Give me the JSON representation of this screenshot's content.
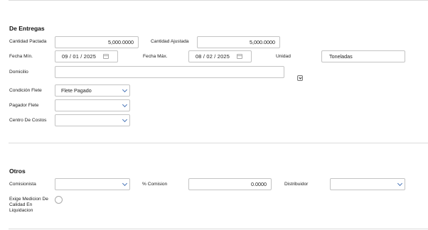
{
  "entregas": {
    "title": "De Entregas",
    "cantidad_pactada": {
      "label": "Cantidad Pactada",
      "value": "5,000.0000"
    },
    "cantidad_ajustada": {
      "label": "Cantidad Ajustada",
      "value": "5,000.0000"
    },
    "fecha_min": {
      "label": "Fecha Mín.",
      "value": "09 / 01 / 2025"
    },
    "fecha_max": {
      "label": "Fecha Máx.",
      "value": "08 / 02 / 2025"
    },
    "unidad": {
      "label": "Unidad",
      "value": "Toneladas"
    },
    "domicilio": {
      "label": "Domicilio",
      "value": ""
    },
    "condicion_flete": {
      "label": "Condición Flete",
      "value": "Flete Pagado"
    },
    "pagador_flete": {
      "label": "Pagador Flete",
      "value": ""
    },
    "centro_costos": {
      "label": "Centro De Costos",
      "value": ""
    }
  },
  "otros": {
    "title": "Otros",
    "comisionista": {
      "label": "Comisionista",
      "value": ""
    },
    "comision": {
      "label": "% Comision",
      "value": "0.0000"
    },
    "distribuidor": {
      "label": "Distribuidor",
      "value": ""
    },
    "exige_medicion": {
      "label": "Exige Medicion De Calidad En Liquidacion",
      "checked": false
    }
  },
  "icons": {
    "calendar": "calendar-icon",
    "chevron": "chevron-down-icon",
    "collapse": "collapse-toggle-icon"
  },
  "colors": {
    "border": "#c4c4c4",
    "chevron": "#4a76b8",
    "divider": "#dcdcdc"
  }
}
